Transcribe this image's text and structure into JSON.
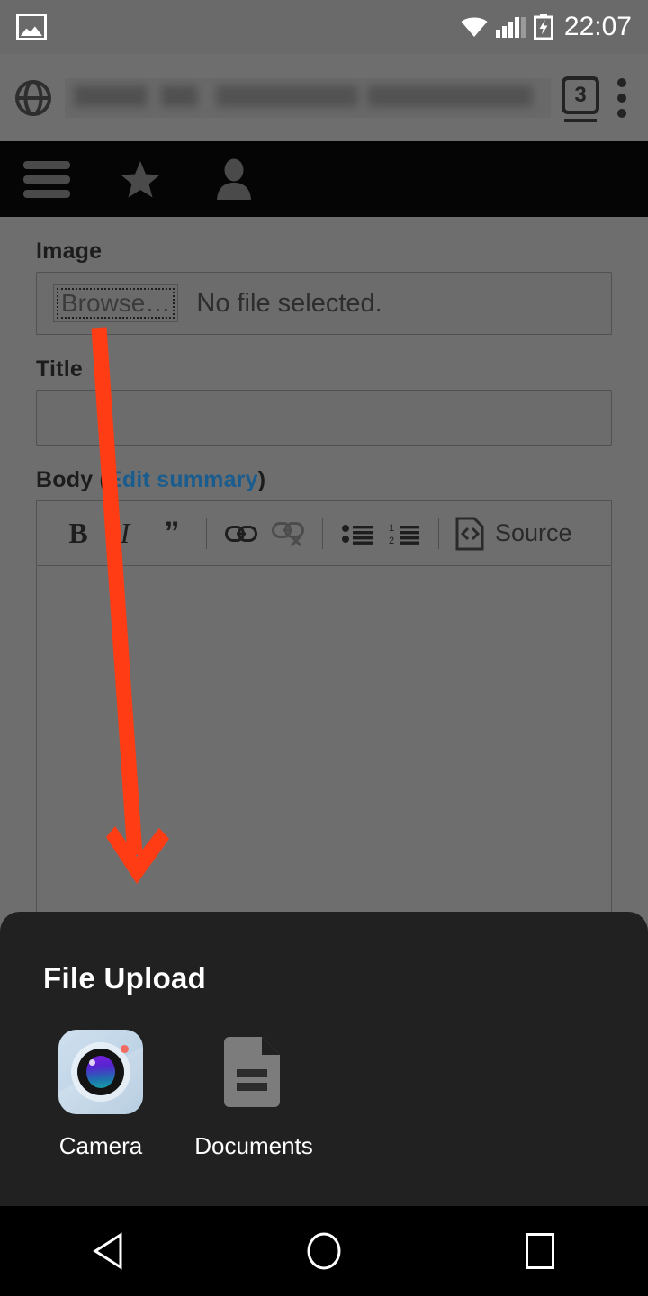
{
  "status_bar": {
    "notification_icon": "gallery-icon",
    "wifi_icon": "wifi-icon",
    "signal_icon": "signal-bars-icon",
    "battery_icon": "battery-charging-icon",
    "time": "22:07"
  },
  "browser": {
    "site_icon": "globe-icon",
    "url_value": "",
    "url_placeholder": "",
    "tab_count": "3",
    "menu_icon": "overflow-menu-icon"
  },
  "site_toolbar": {
    "menu_icon": "hamburger-menu-icon",
    "bookmark_icon": "star-icon",
    "account_icon": "person-icon"
  },
  "form": {
    "image": {
      "label": "Image",
      "browse_label": "Browse…",
      "file_status": "No file selected."
    },
    "title": {
      "label": "Title",
      "value": "",
      "placeholder": ""
    },
    "body": {
      "label_prefix": "Body (",
      "label_link": "Edit summary",
      "label_suffix": ")",
      "toolbar": [
        {
          "name": "bold-button",
          "glyph": "B",
          "disabled": false
        },
        {
          "name": "italic-button",
          "glyph": "I",
          "disabled": false
        },
        {
          "name": "blockquote-button",
          "glyph": "”",
          "disabled": false
        },
        {
          "name": "link-button",
          "glyph": "link-icon",
          "disabled": false
        },
        {
          "name": "unlink-button",
          "glyph": "unlink-icon",
          "disabled": true
        },
        {
          "name": "bulleted-list-button",
          "glyph": "bulleted-list-icon",
          "disabled": false
        },
        {
          "name": "numbered-list-button",
          "glyph": "numbered-list-icon",
          "disabled": false
        }
      ],
      "source_label": "Source",
      "content": ""
    }
  },
  "annotation": {
    "arrow_color": "#FF3C14",
    "points_from": "Browse…",
    "points_to": "File Upload"
  },
  "sheet": {
    "title": "File Upload",
    "items": [
      {
        "label": "Camera",
        "icon": "camera-icon"
      },
      {
        "label": "Documents",
        "icon": "documents-icon"
      }
    ]
  },
  "nav_bar": {
    "back_icon": "back-triangle-icon",
    "home_icon": "home-circle-icon",
    "recents_icon": "recents-square-icon"
  }
}
